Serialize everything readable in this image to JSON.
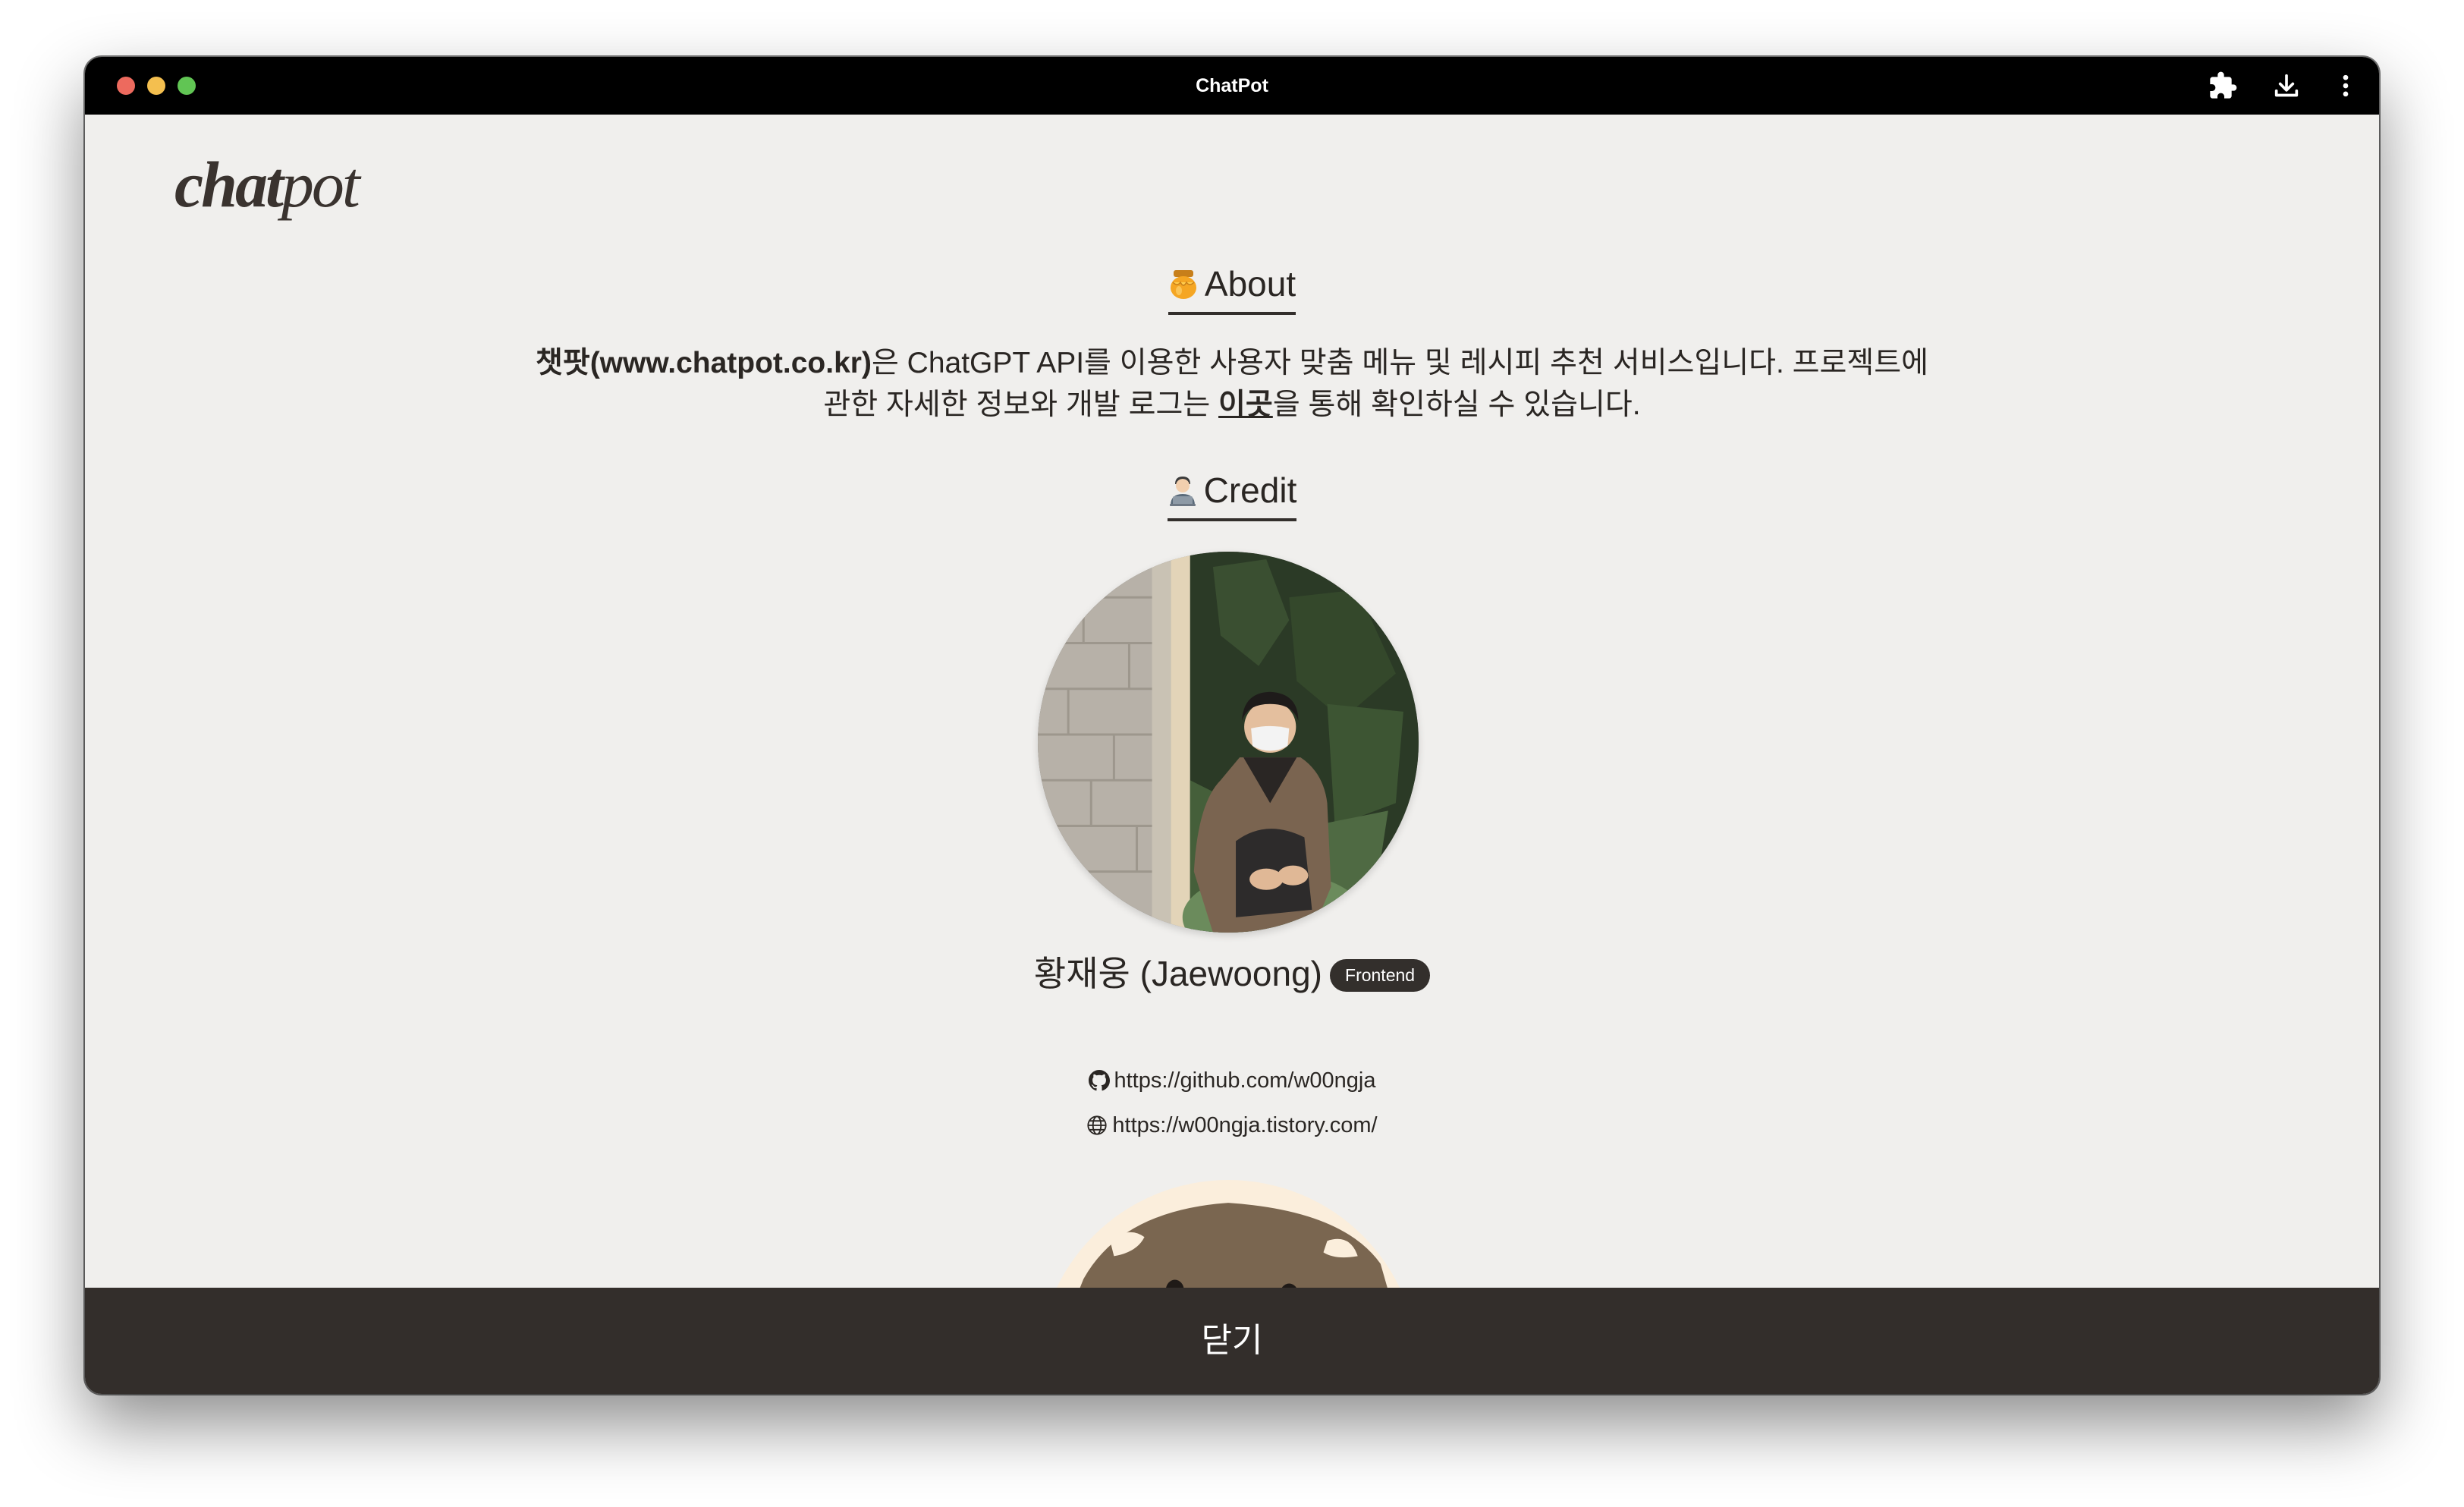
{
  "window": {
    "title": "ChatPot"
  },
  "logo": {
    "bold": "chat",
    "light": "pot"
  },
  "about": {
    "heading": "About",
    "brand": "챗팟(www.chatpot.co.kr)",
    "line1_rest": "은 ChatGPT API를 이용한 사용자 맞춤 메뉴 및 레시피 추천 서비스입니다. 프로젝트에",
    "line2_pre": "관한 자세한 정보와 개발 로그는 ",
    "link": "이곳",
    "line2_post": "을 통해 확인하실 수 있습니다."
  },
  "credit": {
    "heading": "Credit",
    "members": [
      {
        "name": "황재웅 (Jaewoong)",
        "role": "Frontend",
        "github": "https://github.com/w00ngja",
        "blog": "https://w00ngja.tistory.com/"
      }
    ]
  },
  "footer": {
    "close_label": "닫기"
  },
  "icons": {
    "about": "honey-pot-icon",
    "credit": "technologist-icon",
    "github": "github-icon",
    "web": "globe-icon",
    "extensions": "puzzle-icon",
    "download": "download-icon",
    "more": "more-vertical-icon"
  },
  "colors": {
    "background": "#f0efed",
    "dark": "#332e2b",
    "titlebar": "#000000"
  }
}
